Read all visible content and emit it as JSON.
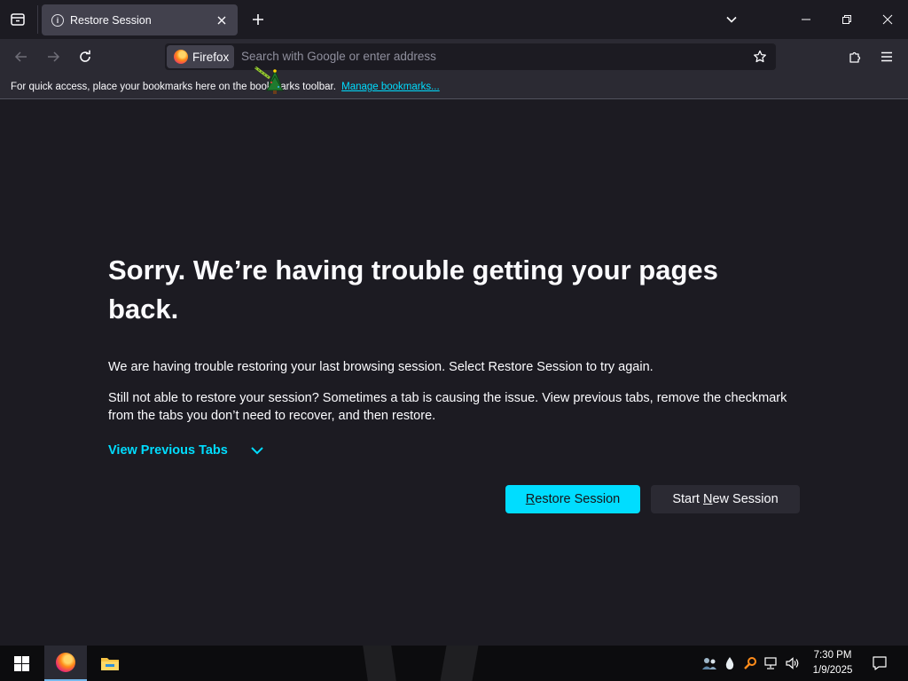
{
  "browser": {
    "tab": {
      "title": "Restore Session"
    },
    "urlbar": {
      "identity_label": "Firefox",
      "placeholder": "Search with Google or enter address"
    },
    "bookmarks_bar": {
      "message": "For quick access, place your bookmarks here on the bookmarks toolbar.",
      "manage_link": "Manage bookmarks..."
    }
  },
  "page": {
    "heading": "Sorry. We’re having trouble getting your pages back.",
    "paragraph1": "We are having trouble restoring your last browsing session. Select Restore Session to try again.",
    "paragraph2": "Still not able to restore your session? Sometimes a tab is causing the issue. View previous tabs, remove the checkmark from the tabs you don’t need to recover, and then restore.",
    "view_previous_tabs": "View Previous Tabs",
    "restore_button": {
      "accesskey": "R",
      "rest": "estore Session"
    },
    "new_session_button": {
      "before": "Start ",
      "accesskey": "N",
      "rest": "ew Session"
    }
  },
  "taskbar": {
    "clock_time": "7:30 PM",
    "clock_date": "1/9/2025",
    "apps": [
      "firefox-icon",
      "file-explorer-icon"
    ]
  },
  "colors": {
    "accent": "#00ddff",
    "background": "#1c1b22",
    "toolbar": "#2b2a33",
    "tab_selected": "#42414d"
  }
}
